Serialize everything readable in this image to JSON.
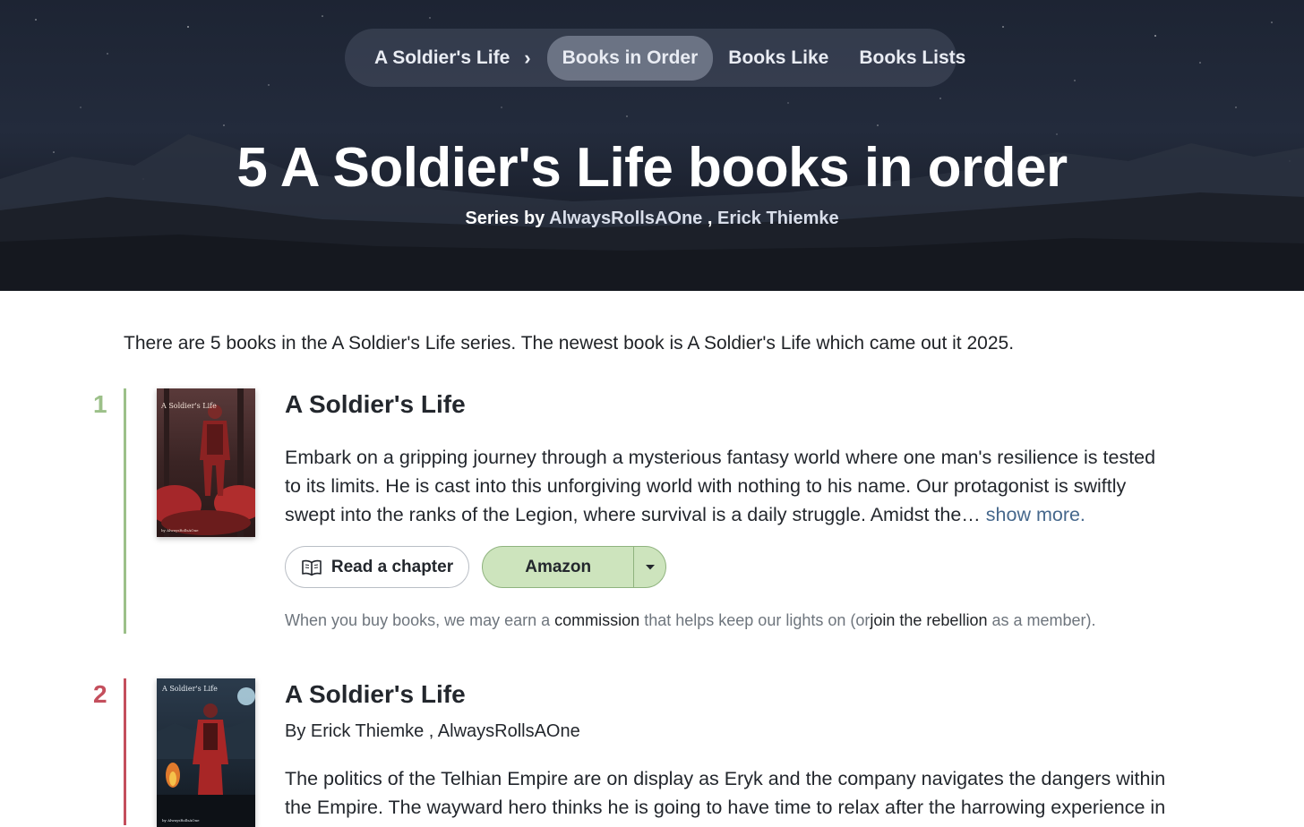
{
  "nav": {
    "series": "A Soldier's Life",
    "separator": "›",
    "active": "Books in Order",
    "books_like": "Books Like",
    "books_lists": "Books Lists"
  },
  "hero": {
    "title": "5 A Soldier's Life books in order",
    "series_by": "Series by",
    "author1": "AlwaysRollsAOne",
    "comma": ",",
    "author2": "Erick Thiemke"
  },
  "intro": "There are 5 books in the A Soldier's Life series. The newest book is A Soldier's Life which came out it 2025.",
  "books": [
    {
      "number": "1",
      "color": "#9cc089",
      "cover_title": "A Soldier's Life",
      "cover_author": "by AlwaysRollsAOne",
      "title": "A Soldier's Life",
      "description": "Embark on a gripping journey through a mysterious fantasy world where one man's resilience is tested to its limits. He is cast into this unforgiving world with nothing to his name. Our protagonist is swiftly swept into the ranks of the Legion, where survival is a daily struggle. Amidst the…",
      "show_more": "show more.",
      "read_label": "Read a chapter",
      "amazon_label": "Amazon"
    },
    {
      "number": "2",
      "color": "#c44f5d",
      "cover_title": "A Soldier's Life",
      "cover_author": "by AlwaysRollsAOne",
      "title": "A Soldier's Life",
      "byline": "By Erick Thiemke , AlwaysRollsAOne",
      "description": "The politics of the Telhian Empire are on display as Eryk and the company navigates the dangers within the Empire. The wayward hero thinks he is going to have time to relax after the harrowing experience in"
    }
  ],
  "affiliate_note": {
    "before": "When you buy books, we may earn a",
    "commission": "commission",
    "middle": "that helps keep our lights on (or",
    "rebellion": "join the rebellion",
    "after": "as a member)."
  }
}
